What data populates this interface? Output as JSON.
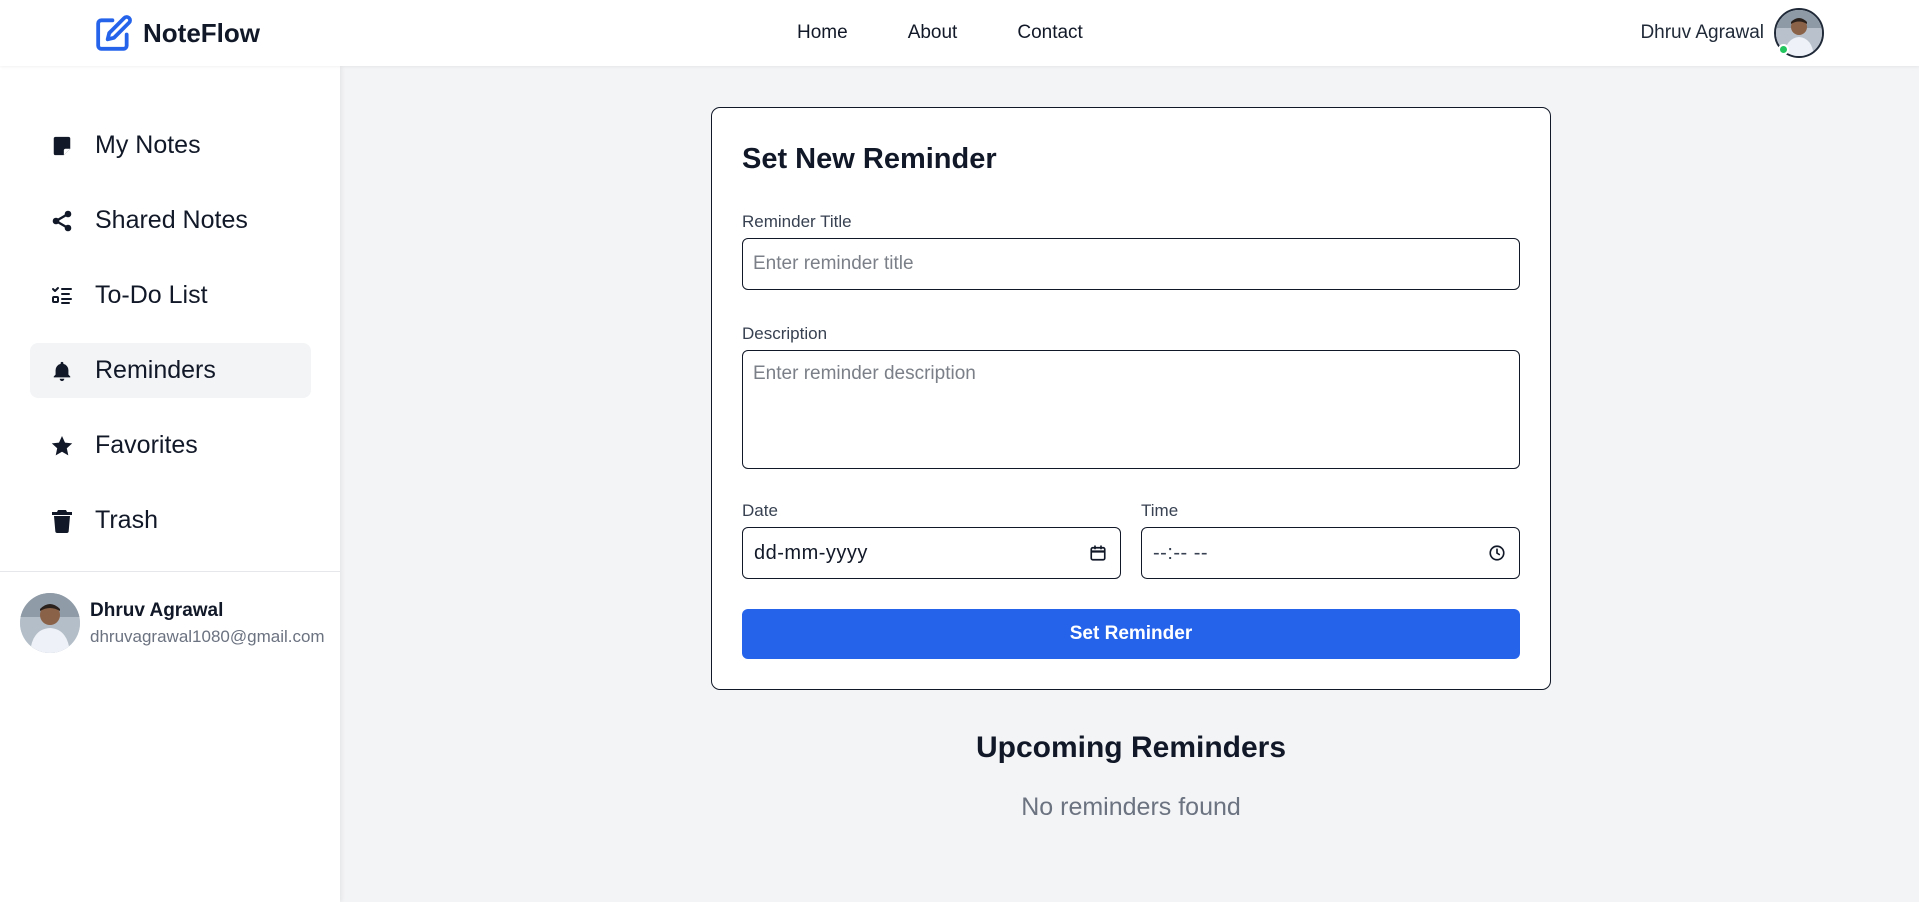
{
  "header": {
    "brand_name": "NoteFlow",
    "brand_icon": "pen-square-icon",
    "nav": [
      {
        "label": "Home"
      },
      {
        "label": "About"
      },
      {
        "label": "Contact"
      }
    ],
    "user_name": "Dhruv Agrawal",
    "online_status_color": "#22c55e"
  },
  "sidebar": {
    "items": [
      {
        "label": "My Notes",
        "icon": "sticky-note-icon",
        "active": false
      },
      {
        "label": "Shared Notes",
        "icon": "share-icon",
        "active": false
      },
      {
        "label": "To-Do List",
        "icon": "checklist-icon",
        "active": false
      },
      {
        "label": "Reminders",
        "icon": "bell-icon",
        "active": true
      },
      {
        "label": "Favorites",
        "icon": "star-icon",
        "active": false
      },
      {
        "label": "Trash",
        "icon": "trash-icon",
        "active": false
      }
    ],
    "profile": {
      "name": "Dhruv Agrawal",
      "email": "dhruvagrawal1080@gmail.com"
    }
  },
  "form": {
    "title": "Set New Reminder",
    "reminder_title": {
      "label": "Reminder Title",
      "placeholder": "Enter reminder title",
      "value": ""
    },
    "description": {
      "label": "Description",
      "placeholder": "Enter reminder description",
      "value": ""
    },
    "date": {
      "label": "Date",
      "display": "dd-mm-yyyy"
    },
    "time": {
      "label": "Time",
      "display": "--:-- --"
    },
    "submit_label": "Set Reminder"
  },
  "upcoming": {
    "title": "Upcoming Reminders",
    "empty_text": "No reminders found"
  },
  "colors": {
    "accent": "#2563eb",
    "page_bg": "#f3f4f6",
    "active_item_bg": "#f3f4f6",
    "muted_text": "#6b7280"
  }
}
